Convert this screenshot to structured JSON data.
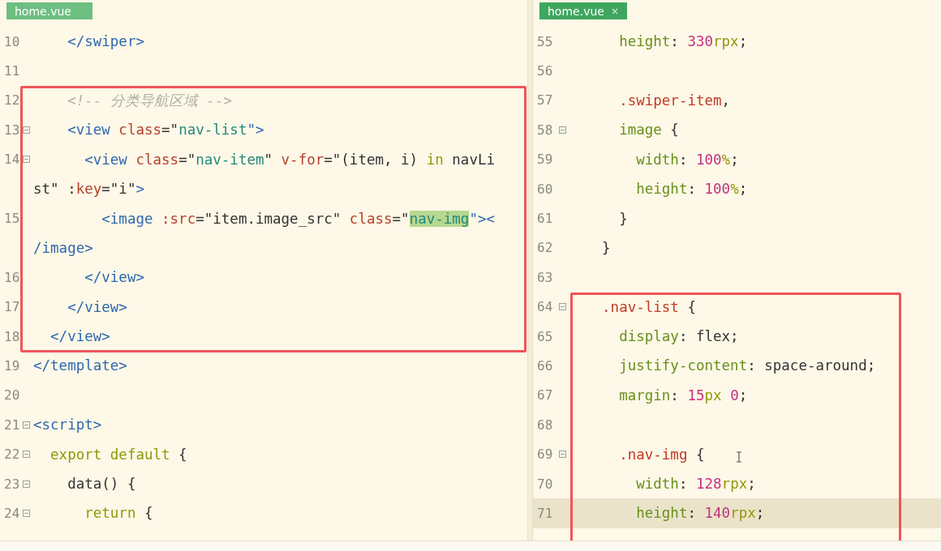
{
  "panes": [
    {
      "tab": {
        "label": "home.vue",
        "active": false
      },
      "lines": [
        {
          "number": "10",
          "fold": false,
          "framed": false,
          "current": false,
          "tokens": [
            {
              "t": "    </swiper>",
              "kind": "tag"
            }
          ]
        },
        {
          "number": "11",
          "fold": false,
          "framed": false,
          "current": false
        },
        {
          "number": "12",
          "fold": false,
          "framed": true,
          "current": false,
          "tokens": [
            {
              "t": "    <!-- 分类导航区域 -->",
              "kind": "comment"
            }
          ]
        },
        {
          "number": "13",
          "fold": true,
          "framed": true,
          "current": false,
          "tokens": [
            {
              "t": "    <view ",
              "kind": "tag"
            },
            {
              "t": "class",
              "kind": "attr"
            },
            {
              "t": "=\"",
              "kind": "plain"
            },
            {
              "t": "nav-list",
              "kind": "str"
            },
            {
              "t": "\">",
              "kind": "tag"
            }
          ]
        },
        {
          "number": "14",
          "fold": true,
          "framed": true,
          "current": false,
          "tokens": [
            {
              "t": "      <view ",
              "kind": "tag"
            },
            {
              "t": "class",
              "kind": "attr"
            },
            {
              "t": "=\"",
              "kind": "plain"
            },
            {
              "t": "nav-item",
              "kind": "str"
            },
            {
              "t": "\" ",
              "kind": "plain"
            },
            {
              "t": "v-for",
              "kind": "attr"
            },
            {
              "t": "=\"(item, i) ",
              "kind": "plain"
            },
            {
              "t": "in",
              "kind": "kw"
            },
            {
              "t": " navLi",
              "kind": "plain"
            }
          ]
        },
        {
          "framed": true,
          "fold": false,
          "current": false,
          "tokens": [
            {
              "t": "st\" :",
              "kind": "plain"
            },
            {
              "t": "key",
              "kind": "attr"
            },
            {
              "t": "=\"i\"",
              "kind": "plain"
            },
            {
              "t": ">",
              "kind": "tag"
            }
          ]
        },
        {
          "number": "15",
          "fold": false,
          "framed": true,
          "current": false,
          "tokens": [
            {
              "t": "        <image ",
              "kind": "tag"
            },
            {
              "t": ":src",
              "kind": "attr"
            },
            {
              "t": "=\"item.image_src\" ",
              "kind": "plain"
            },
            {
              "t": "class",
              "kind": "attr"
            },
            {
              "t": "=\"",
              "kind": "plain"
            },
            {
              "t": "nav-img",
              "kind": "str",
              "highlight": true
            },
            {
              "t": "\"><",
              "kind": "tag"
            }
          ]
        },
        {
          "framed": true,
          "fold": false,
          "current": false,
          "tokens": [
            {
              "t": "/image>",
              "kind": "tag"
            }
          ]
        },
        {
          "number": "16",
          "fold": false,
          "framed": true,
          "current": false,
          "tokens": [
            {
              "t": "      </view>",
              "kind": "tag"
            }
          ]
        },
        {
          "number": "17",
          "fold": false,
          "framed": true,
          "current": false,
          "tokens": [
            {
              "t": "    </view>",
              "kind": "tag"
            }
          ]
        },
        {
          "number": "18",
          "fold": false,
          "framed": true,
          "current": false,
          "tokens": [
            {
              "t": "  </view>",
              "kind": "tag"
            }
          ]
        },
        {
          "number": "19",
          "fold": false,
          "framed": false,
          "current": false,
          "tokens": [
            {
              "t": "</template>",
              "kind": "tag"
            }
          ]
        },
        {
          "number": "20",
          "fold": false,
          "framed": false,
          "current": false
        },
        {
          "number": "21",
          "fold": true,
          "framed": false,
          "current": false,
          "tokens": [
            {
              "t": "<script>",
              "kind": "tag"
            }
          ]
        },
        {
          "number": "22",
          "fold": true,
          "framed": false,
          "current": false,
          "tokens": [
            {
              "t": "  export default",
              "kind": "kw"
            },
            {
              "t": " {",
              "kind": "plain"
            }
          ]
        },
        {
          "number": "23",
          "fold": true,
          "framed": false,
          "current": false,
          "tokens": [
            {
              "t": "    data() {",
              "kind": "plain"
            }
          ]
        },
        {
          "number": "24",
          "fold": true,
          "framed": false,
          "current": false,
          "tokens": [
            {
              "t": "      return",
              "kind": "kw"
            },
            {
              "t": " {",
              "kind": "plain"
            }
          ]
        }
      ]
    },
    {
      "tab": {
        "label": "home.vue",
        "active": true,
        "close": "×"
      },
      "lines": [
        {
          "number": "55",
          "fold": false,
          "framed": false,
          "current": false,
          "tokens": [
            {
              "t": "    height",
              "kind": "prop"
            },
            {
              "t": ": ",
              "kind": "plain"
            },
            {
              "t": "330",
              "kind": "num"
            },
            {
              "t": "rpx",
              "kind": "unit"
            },
            {
              "t": ";",
              "kind": "plain"
            }
          ]
        },
        {
          "number": "56",
          "fold": false,
          "framed": false,
          "current": false
        },
        {
          "number": "57",
          "fold": false,
          "framed": false,
          "current": false,
          "tokens": [
            {
              "t": "    .swiper-item",
              "kind": "sel"
            },
            {
              "t": ",",
              "kind": "plain"
            }
          ]
        },
        {
          "number": "58",
          "fold": true,
          "framed": false,
          "current": false,
          "tokens": [
            {
              "t": "    image",
              "kind": "prop"
            },
            {
              "t": " {",
              "kind": "plain"
            }
          ]
        },
        {
          "number": "59",
          "fold": false,
          "framed": false,
          "current": false,
          "tokens": [
            {
              "t": "      width",
              "kind": "prop"
            },
            {
              "t": ": ",
              "kind": "plain"
            },
            {
              "t": "100",
              "kind": "num"
            },
            {
              "t": "%",
              "kind": "unit"
            },
            {
              "t": ";",
              "kind": "plain"
            }
          ]
        },
        {
          "number": "60",
          "fold": false,
          "framed": false,
          "current": false,
          "tokens": [
            {
              "t": "      height",
              "kind": "prop"
            },
            {
              "t": ": ",
              "kind": "plain"
            },
            {
              "t": "100",
              "kind": "num"
            },
            {
              "t": "%",
              "kind": "unit"
            },
            {
              "t": ";",
              "kind": "plain"
            }
          ]
        },
        {
          "number": "61",
          "fold": false,
          "framed": false,
          "current": false,
          "tokens": [
            {
              "t": "    }",
              "kind": "plain"
            }
          ]
        },
        {
          "number": "62",
          "fold": false,
          "framed": false,
          "current": false,
          "tokens": [
            {
              "t": "  }",
              "kind": "plain"
            }
          ]
        },
        {
          "number": "63",
          "fold": false,
          "framed": false,
          "current": false
        },
        {
          "number": "64",
          "fold": true,
          "framed": true,
          "current": false,
          "tokens": [
            {
              "t": "  .nav-list",
              "kind": "sel"
            },
            {
              "t": " {",
              "kind": "plain"
            }
          ]
        },
        {
          "number": "65",
          "fold": false,
          "framed": true,
          "current": false,
          "tokens": [
            {
              "t": "    display",
              "kind": "prop"
            },
            {
              "t": ": flex;",
              "kind": "plain"
            }
          ]
        },
        {
          "number": "66",
          "fold": false,
          "framed": true,
          "current": false,
          "tokens": [
            {
              "t": "    justify-content",
              "kind": "prop"
            },
            {
              "t": ": space-around;",
              "kind": "plain"
            }
          ]
        },
        {
          "number": "67",
          "fold": false,
          "framed": true,
          "current": false,
          "tokens": [
            {
              "t": "    margin",
              "kind": "prop"
            },
            {
              "t": ": ",
              "kind": "plain"
            },
            {
              "t": "15",
              "kind": "num"
            },
            {
              "t": "px",
              "kind": "unit"
            },
            {
              "t": " 0",
              "kind": "num"
            },
            {
              "t": ";",
              "kind": "plain"
            }
          ]
        },
        {
          "number": "68",
          "fold": false,
          "framed": true,
          "current": false
        },
        {
          "number": "69",
          "fold": true,
          "framed": true,
          "current": false,
          "tokens": [
            {
              "t": "    .nav-img",
              "kind": "sel"
            },
            {
              "t": " {",
              "kind": "plain"
            }
          ]
        },
        {
          "number": "70",
          "fold": false,
          "framed": true,
          "current": false,
          "tokens": [
            {
              "t": "      width",
              "kind": "prop"
            },
            {
              "t": ": ",
              "kind": "plain"
            },
            {
              "t": "128",
              "kind": "num"
            },
            {
              "t": "rpx",
              "kind": "unit"
            },
            {
              "t": ";",
              "kind": "plain"
            }
          ]
        },
        {
          "number": "71",
          "fold": false,
          "framed": true,
          "current": true,
          "tokens": [
            {
              "t": "      height",
              "kind": "prop"
            },
            {
              "t": ": ",
              "kind": "plain"
            },
            {
              "t": "140",
              "kind": "num"
            },
            {
              "t": "rpx",
              "kind": "unit"
            },
            {
              "t": ";",
              "kind": "plain"
            }
          ]
        }
      ]
    }
  ]
}
